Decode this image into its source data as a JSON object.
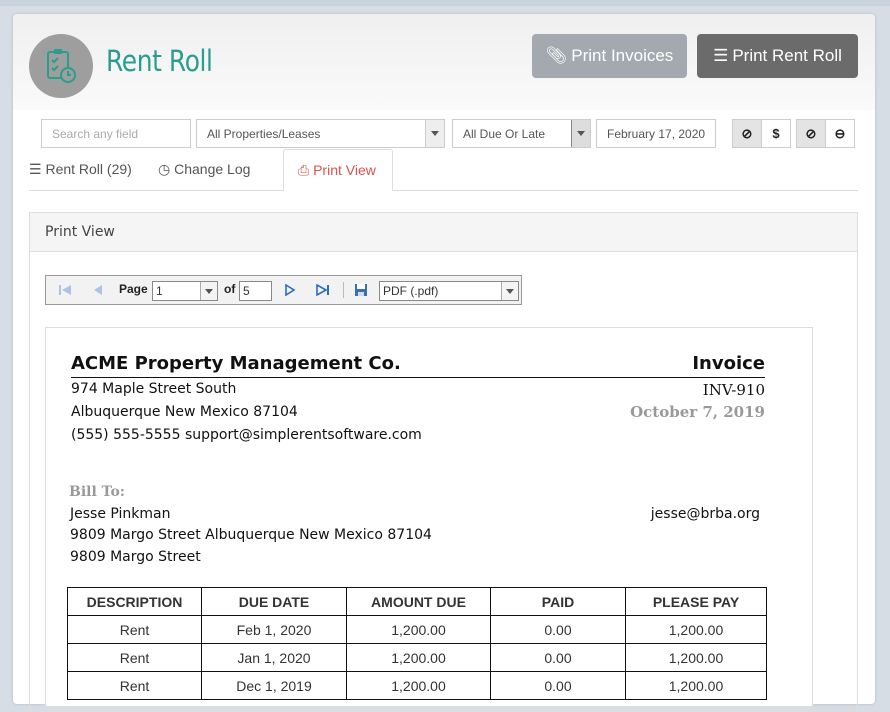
{
  "app": {
    "title": "Rent Roll",
    "print_invoices_label": "Print Invoices",
    "print_rent_roll_label": "Print Rent Roll",
    "accent": "#2a9d8f"
  },
  "filters": {
    "search_placeholder": "Search any field",
    "property": "All Properties/Leases",
    "due_status": "All Due Or Late",
    "date": "February 17, 2020"
  },
  "toolbar": {
    "buttons": [
      {
        "icon": "ban-icon",
        "glyph": "⊘"
      },
      {
        "icon": "dollar-icon",
        "glyph": "$"
      },
      {
        "icon": "ban-icon",
        "glyph": "⊘"
      },
      {
        "icon": "minus-circle-icon",
        "glyph": "⊖"
      }
    ]
  },
  "tabs": [
    {
      "label": "Rent Roll (29)",
      "icon": "list-icon"
    },
    {
      "label": "Change Log",
      "icon": "clock-icon"
    },
    {
      "label": "Print View",
      "icon": "print-icon",
      "active": true
    }
  ],
  "panel": {
    "title": "Print View"
  },
  "report_viewer": {
    "page_label": "Page",
    "page_value": "1",
    "of_label": "of",
    "total_pages": "5",
    "export_format": "PDF (.pdf)"
  },
  "invoice": {
    "company": "ACME Property Management Co.",
    "address1": "974 Maple Street South",
    "address2": "Albuquerque New Mexico 87104",
    "contact": "(555) 555-5555 support@simplerentsoftware.com",
    "label": "Invoice",
    "number": "INV-910",
    "date": "October 7, 2019",
    "bill_to_label": "Bill To:",
    "tenant_name": "Jesse Pinkman",
    "tenant_address1": "9809 Margo Street Albuquerque New Mexico 87104",
    "tenant_address2": "9809 Margo Street",
    "tenant_email": "jesse@brba.org",
    "columns": [
      "DESCRIPTION",
      "DUE DATE",
      "AMOUNT DUE",
      "PAID",
      "PLEASE PAY"
    ],
    "rows": [
      [
        "Rent",
        "Feb 1, 2020",
        "1,200.00",
        "0.00",
        "1,200.00"
      ],
      [
        "Rent",
        "Jan 1, 2020",
        "1,200.00",
        "0.00",
        "1,200.00"
      ],
      [
        "Rent",
        "Dec 1, 2019",
        "1,200.00",
        "0.00",
        "1,200.00"
      ]
    ]
  }
}
